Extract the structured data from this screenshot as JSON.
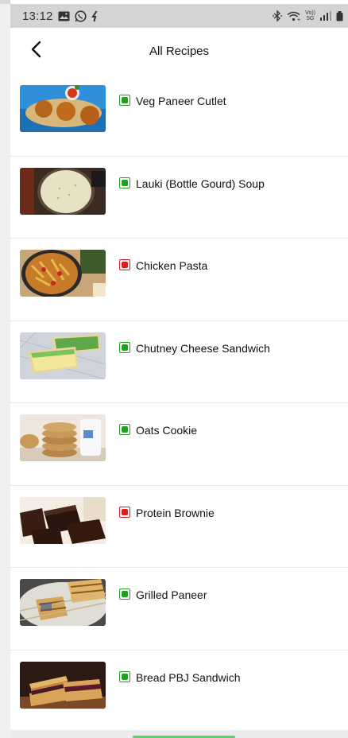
{
  "status_bar": {
    "time": "13:12",
    "left_icons": [
      "gallery-icon",
      "whatsapp-icon",
      "activity-icon"
    ],
    "right_icons": [
      "bluetooth-icon",
      "wifi-icon",
      "volte-icon",
      "signal-icon",
      "battery-icon"
    ],
    "network_label_top": "Vo))",
    "network_label_bottom": "5G"
  },
  "header": {
    "title": "All Recipes",
    "back_icon": "chevron-left-icon"
  },
  "colors": {
    "veg": "#1ea21e",
    "nonveg": "#e21b1b",
    "divider": "#e6e6e6"
  },
  "recipes": [
    {
      "name": "Veg Paneer Cutlet",
      "type": "veg",
      "image": "paneer-cutlet"
    },
    {
      "name": "Lauki (Bottle Gourd) Soup",
      "type": "veg",
      "image": "lauki-soup"
    },
    {
      "name": "Chicken Pasta",
      "type": "nonveg",
      "image": "chicken-pasta"
    },
    {
      "name": "Chutney Cheese Sandwich",
      "type": "veg",
      "image": "chutney-sandwich"
    },
    {
      "name": "Oats Cookie",
      "type": "veg",
      "image": "oats-cookie"
    },
    {
      "name": "Protein Brownie",
      "type": "nonveg",
      "image": "protein-brownie"
    },
    {
      "name": "Grilled Paneer",
      "type": "veg",
      "image": "grilled-paneer"
    },
    {
      "name": "Bread PBJ Sandwich",
      "type": "veg",
      "image": "pbj-sandwich"
    }
  ]
}
